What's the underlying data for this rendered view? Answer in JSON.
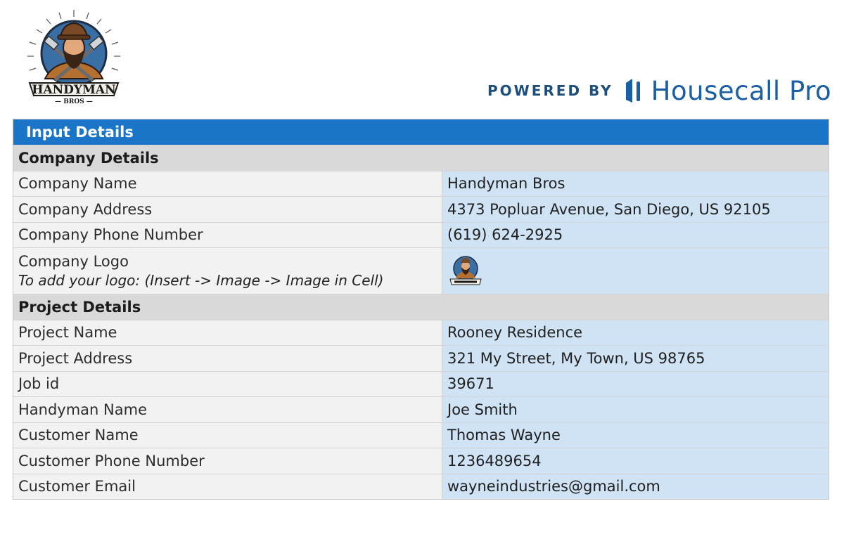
{
  "header": {
    "logo": {
      "icon": "handyman-bros-logo-icon",
      "text_line1": "HANDYMAN",
      "text_line2": "BROS"
    },
    "powered_by": "POWERED BY",
    "brand_icon": "housecall-pro-logo-icon",
    "brand_name": "Housecall Pro"
  },
  "table": {
    "title": "Input Details",
    "company_section": "Company Details",
    "company_rows": [
      {
        "label": "Company Name",
        "value": "Handyman Bros"
      },
      {
        "label": "Company Address",
        "value": "4373 Popluar Avenue, San Diego, US 92105"
      },
      {
        "label": "Company Phone Number",
        "value": "(619) 624-2925"
      }
    ],
    "logo_row": {
      "label": "Company Logo",
      "hint": "To add your logo: (Insert -> Image -> Image in Cell)",
      "value_icon": "company-logo-thumbnail-icon"
    },
    "project_section": "Project Details",
    "project_rows": [
      {
        "label": "Project Name",
        "value": "Rooney Residence"
      },
      {
        "label": "Project Address",
        "value": "321 My Street, My Town, US 98765"
      },
      {
        "label": "Job id",
        "value": "39671"
      },
      {
        "label": "Handyman Name",
        "value": "Joe Smith"
      },
      {
        "label": "Customer Name",
        "value": "Thomas Wayne"
      },
      {
        "label": "Customer Phone Number",
        "value": "1236489654"
      },
      {
        "label": "Customer Email",
        "value": "wayneindustries@gmail.com"
      }
    ]
  },
  "colors": {
    "banner": "#1a75c9",
    "section": "#d9d9d9",
    "label_cell": "#f2f2f2",
    "value_cell": "#cfe3f5",
    "brand": "#1a5ea3"
  }
}
